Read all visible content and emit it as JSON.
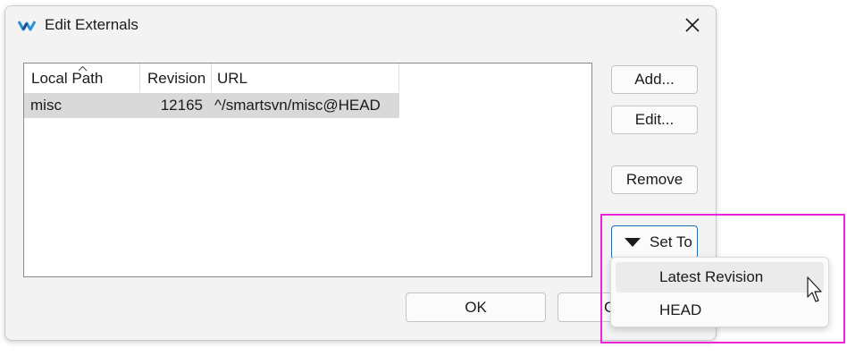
{
  "window": {
    "title": "Edit Externals",
    "app_icon": "smartsvn-logo-icon",
    "close_icon": "close-icon"
  },
  "table": {
    "columns": [
      "Local Path",
      "Revision",
      "URL"
    ],
    "sorted_column": "Local Path",
    "sort_icon": "sort-caret-up-icon",
    "rows": [
      {
        "local_path": "misc",
        "revision": "12165",
        "url": "^/smartsvn/misc@HEAD",
        "selected": true
      }
    ]
  },
  "buttons": {
    "add": "Add...",
    "edit": "Edit...",
    "remove": "Remove",
    "set_to": "Set To",
    "set_to_icon": "dropdown-triangle-icon",
    "ok": "OK",
    "cancel": "C"
  },
  "set_to_menu": {
    "items": [
      "Latest Revision",
      "HEAD"
    ],
    "hovered_item": "Latest Revision"
  },
  "colors": {
    "highlight_border": "#ee22d6",
    "selected_row": "#d9d9d9",
    "focused_button_border": "#1f6fb2",
    "app_icon": "#2a8fd6"
  },
  "cursor_icon": "mouse-pointer-icon"
}
